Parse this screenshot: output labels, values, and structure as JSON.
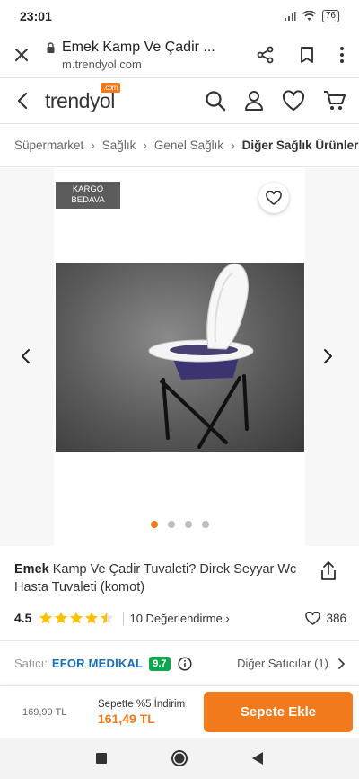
{
  "status": {
    "time": "23:01",
    "battery": "76"
  },
  "browser": {
    "title": "Emek Kamp Ve Çadir ...",
    "url": "m.trendyol.com"
  },
  "site": {
    "logo_text": "trendyol",
    "logo_badge": ".com"
  },
  "breadcrumb": [
    "Süpermarket",
    "Sağlık",
    "Genel Sağlık",
    "Diğer Sağlık Ürünleri"
  ],
  "gallery": {
    "badge_line1": "KARGO",
    "badge_line2": "BEDAVA",
    "image_count": 4,
    "active_index": 0
  },
  "product": {
    "brand": "Emek",
    "title": "Kamp Ve Çadir Tuvaleti? Direk Seyyar Wc Hasta Tuvaleti (komot)",
    "rating": "4.5",
    "rating_value": 4.5,
    "review_count_label": "10 Değerlendirme",
    "favorite_count": "386"
  },
  "seller": {
    "label": "Satıcı:",
    "name": "EFOR MEDİKAL",
    "score": "9.7",
    "other_sellers": "Diğer Satıcılar (1)"
  },
  "cart": {
    "old_price": "169,99 TL",
    "discount_label": "Sepette %5 İndirim",
    "discount_price": "161,49 TL",
    "button_label": "Sepete Ekle"
  },
  "colors": {
    "brand_orange": "#f27a1a",
    "seller_blue": "#1b6fb5",
    "score_green": "#10a650"
  }
}
